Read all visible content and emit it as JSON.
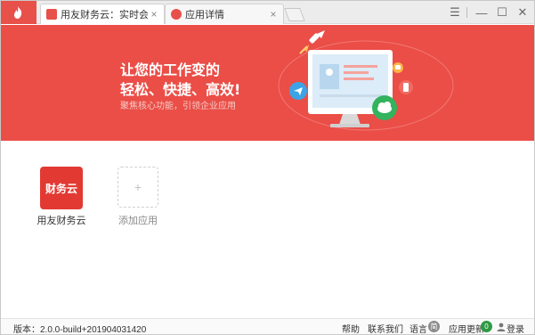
{
  "window": {
    "tabs": [
      {
        "label": "用友财务云：实时会计 智...",
        "close": "×"
      },
      {
        "label": "应用详情",
        "close": "×"
      }
    ],
    "controls": {
      "menu": "☰",
      "minimize": "—",
      "maximize": "☐",
      "close": "✕"
    }
  },
  "banner": {
    "title_line1": "让您的工作变的",
    "title_line2": "轻松、快捷、高效!",
    "subtitle": "聚焦核心功能，引领企业应用"
  },
  "apps": [
    {
      "tile_text": "财务云",
      "label": "用友财务云"
    }
  ],
  "add_app": {
    "symbol": "+",
    "label": "添加应用"
  },
  "status": {
    "version": "版本：2.0.0-build+201904031420",
    "help": "帮助",
    "contact": "联系我们",
    "language": "语言",
    "language_badge": "简",
    "update": "应用更新",
    "update_count": "0",
    "login": "登录"
  },
  "colors": {
    "brand_red": "#ea4e47",
    "tile_red": "#e23a33",
    "update_badge_green": "#2f9a44"
  }
}
